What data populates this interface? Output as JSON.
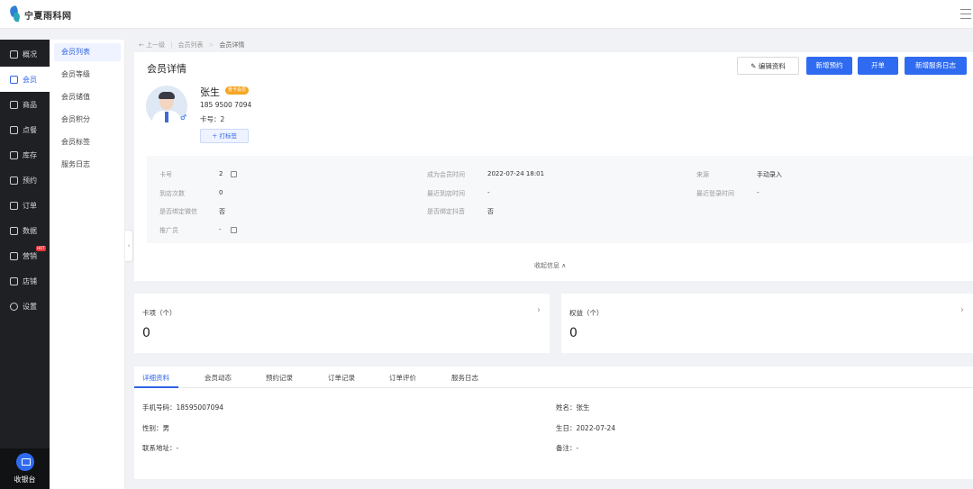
{
  "header": {
    "logo_text": "宁夏雨科网"
  },
  "left_nav": {
    "items": [
      {
        "label": "概况",
        "icon": "grid-icon"
      },
      {
        "label": "会员",
        "icon": "crown-icon"
      },
      {
        "label": "商品",
        "icon": "box-icon"
      },
      {
        "label": "点餐",
        "icon": "dish-icon"
      },
      {
        "label": "库存",
        "icon": "warehouse-icon"
      },
      {
        "label": "预约",
        "icon": "calendar-check-icon"
      },
      {
        "label": "订单",
        "icon": "order-icon"
      },
      {
        "label": "数据",
        "icon": "chart-icon"
      },
      {
        "label": "营销",
        "icon": "gift-icon",
        "badge": "HOT"
      },
      {
        "label": "店铺",
        "icon": "store-icon"
      },
      {
        "label": "设置",
        "icon": "settings-icon"
      }
    ],
    "active_index": 1,
    "cashier_label": "收银台"
  },
  "sub_nav": {
    "items": [
      "会员列表",
      "会员等级",
      "会员储值",
      "会员积分",
      "会员标签",
      "服务日志"
    ],
    "active_index": 0
  },
  "breadcrumb": {
    "back": "← 上一级",
    "parent": "会员列表",
    "sep": ">",
    "current": "会员详情"
  },
  "page": {
    "title": "会员详情",
    "buttons": {
      "edit": "编辑资料",
      "new_booking": "新增预约",
      "open_order": "开单",
      "new_service_log": "新增服务日志"
    }
  },
  "member": {
    "name": "张生",
    "level_badge": "普卡会员",
    "gender_symbol": "♂",
    "phone": "185 9500 7094",
    "card_no": "卡号：2",
    "tag_button": "＋ 打标签"
  },
  "info": {
    "fields": [
      {
        "label": "卡号",
        "value": "2"
      },
      {
        "label": "到店次数",
        "value": "0"
      },
      {
        "label": "是否绑定微信",
        "value": "否"
      },
      {
        "label": "推广员",
        "value": "-"
      },
      {
        "label": "成为会员时间",
        "value": "2022-07-24 18:01"
      },
      {
        "label": "最近到店时间",
        "value": "-"
      },
      {
        "label": "是否绑定抖音",
        "value": "否"
      },
      {
        "label": "来源",
        "value": "手动录入"
      },
      {
        "label": "最近登录时间",
        "value": "-"
      }
    ],
    "collapse_label": "收起信息  ∧"
  },
  "stats": [
    {
      "title": "卡项（个）",
      "value": "0"
    },
    {
      "title": "权益（个）",
      "value": "0"
    }
  ],
  "tabs": {
    "items": [
      "详细资料",
      "会员动态",
      "预约记录",
      "订单记录",
      "订单评价",
      "服务日志"
    ],
    "active_index": 0
  },
  "details": {
    "mobile": "手机号码：18595007094",
    "gender": "性别：男",
    "address": "联系地址：-",
    "name": "姓名：张生",
    "birthday": "生日：2022-07-24",
    "remark": "备注：-"
  }
}
